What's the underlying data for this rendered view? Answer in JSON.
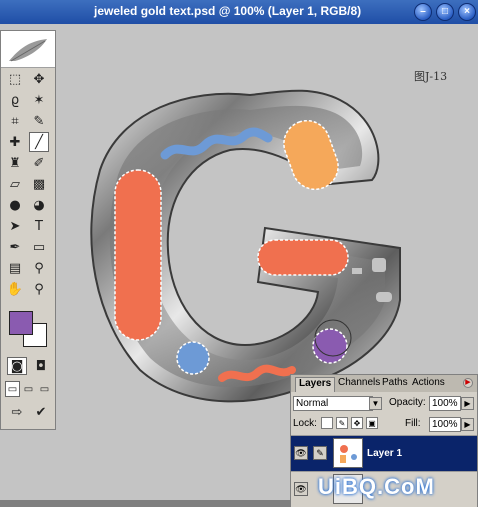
{
  "window": {
    "title": "jeweled gold text.psd @ 100% (Layer 1, RGB/8)",
    "buttons": [
      "minimize",
      "maximize",
      "close"
    ]
  },
  "canvas": {
    "figure_label": "图J-13",
    "artwork": {
      "letter": "G",
      "colors": {
        "orange": "#f0704f",
        "yellow_orange": "#f5a85a",
        "blue": "#6d9ad6",
        "purple": "#8a5bb0",
        "chrome": "#9a9a9a"
      }
    }
  },
  "toolbox": {
    "tools": [
      "marquee",
      "move",
      "lasso",
      "magic-wand",
      "crop",
      "slice",
      "healing-brush",
      "brush",
      "stamp",
      "history-brush",
      "eraser",
      "gradient",
      "blur",
      "dodge",
      "path-select",
      "type",
      "pen",
      "shape",
      "notes",
      "eyedropper",
      "hand",
      "zoom"
    ],
    "foreground_color": "#8a5bb0",
    "background_color": "#ffffff"
  },
  "layers_panel": {
    "tabs": [
      "Layers",
      "Channels",
      "Paths",
      "Actions"
    ],
    "active_tab": "Layers",
    "blend_mode": "Normal",
    "opacity_label": "Opacity:",
    "opacity": "100%",
    "lock_label": "Lock:",
    "fill_label": "Fill:",
    "fill": "100%",
    "layers": [
      {
        "name": "Layer 1",
        "selected": true
      },
      {
        "name": "",
        "selected": false
      }
    ]
  },
  "watermark": "UiBQ.CoM"
}
